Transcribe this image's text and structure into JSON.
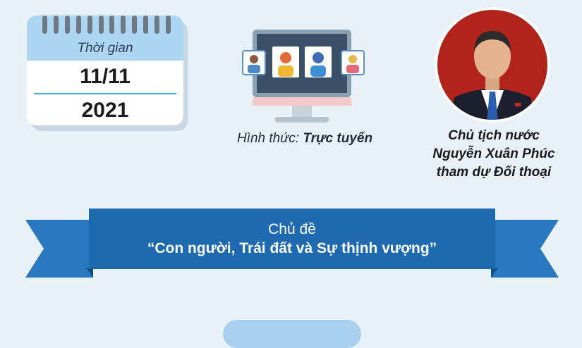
{
  "calendar": {
    "label": "Thời gian",
    "date": "11/11",
    "year": "2021"
  },
  "format": {
    "label": "Hình thức:",
    "value": "Trực tuyến"
  },
  "attendee": {
    "line1": "Chủ tịch nước",
    "line2": "Nguyễn Xuân Phúc",
    "line3": "tham dự Đối thoại"
  },
  "theme": {
    "title": "Chủ đề",
    "text": "“Con người, Trái đất và Sự thịnh vượng”"
  },
  "colors": {
    "background": "#e9f1f8",
    "ribbon": "#1f69b1",
    "ribbon_dark": "#134c86",
    "calendar_header": "#acd6f1",
    "accent": "#4ba6dc"
  }
}
